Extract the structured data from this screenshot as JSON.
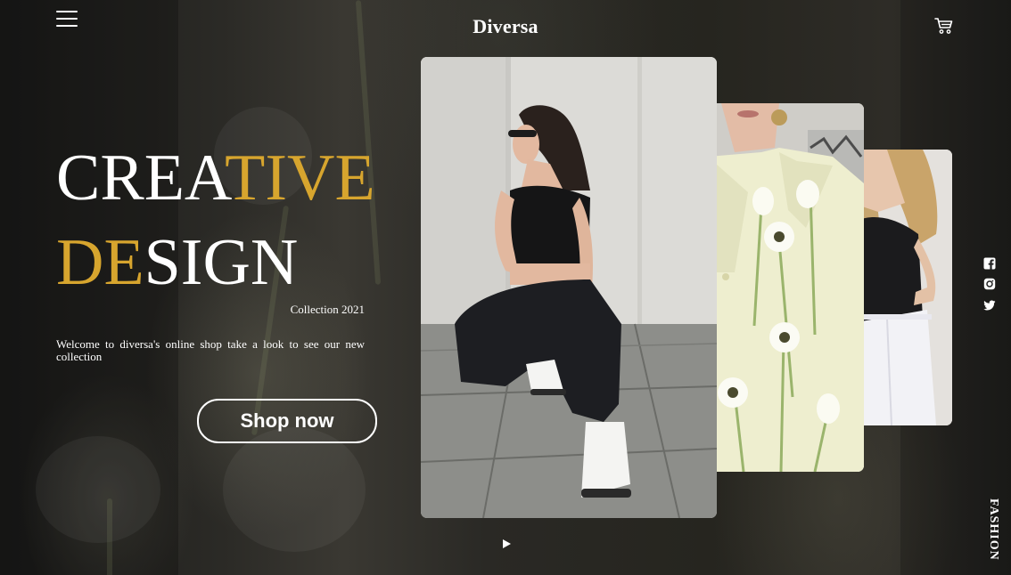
{
  "header": {
    "brand": "Diversa",
    "menu_icon": "hamburger-menu-icon",
    "cart_icon": "shopping-cart-icon"
  },
  "hero": {
    "line1": {
      "white": "CREA",
      "gold": "TIVE"
    },
    "line2": {
      "gold": "DE",
      "white": "SIGN"
    },
    "collection": "Collection 2021",
    "welcome": "Welcome to diversa's online shop take a look to see our new collection",
    "cta_label": "Shop now"
  },
  "gallery": {
    "cards": [
      {
        "subject": "woman in black crop top and jeans crouching in white sneakers"
      },
      {
        "subject": "pale yellow blazer decorated with white daisies"
      },
      {
        "subject": "woman in black camisole and white jeans"
      }
    ],
    "play_icon": "play-icon"
  },
  "social": {
    "icons": [
      "facebook-icon",
      "instagram-icon",
      "twitter-icon"
    ]
  },
  "side_label": "FASHION",
  "colors": {
    "accent": "#d7a52e",
    "background": "#2a2925",
    "text": "#ffffff"
  }
}
